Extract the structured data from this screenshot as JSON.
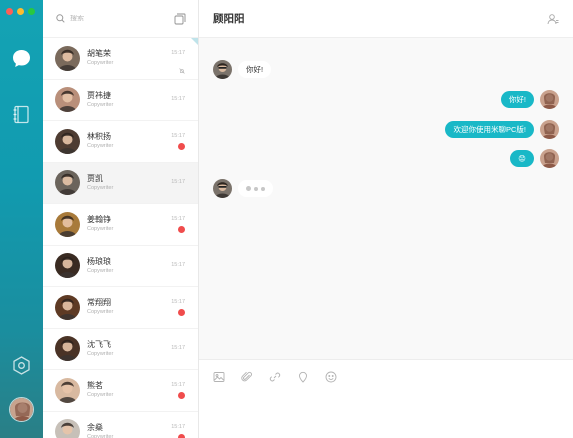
{
  "app": {
    "accent": "#19b8c7",
    "rail_gradient": [
      "#14a3b4",
      "#2a7f86"
    ]
  },
  "rail": {
    "items": [
      {
        "icon": "chat-bubble-icon"
      },
      {
        "icon": "contacts-book-icon"
      },
      {
        "icon": "settings-hex-icon"
      }
    ]
  },
  "list": {
    "search_placeholder": "搜索",
    "contacts": [
      {
        "name": "胡笔荣",
        "subtitle": "Copywriter",
        "time": "15:17",
        "indicator": "mute",
        "avatar": "#7a6a5c"
      },
      {
        "name": "贾祎捷",
        "subtitle": "Copywriter",
        "time": "15:17",
        "indicator": "none",
        "avatar": "#b98f7a"
      },
      {
        "name": "林积扬",
        "subtitle": "Copywriter",
        "time": "15:17",
        "indicator": "unread",
        "avatar": "#4e3c32"
      },
      {
        "name": "贾凯",
        "subtitle": "Copywriter",
        "time": "15:17",
        "indicator": "none",
        "avatar": "#6b645c",
        "active": true
      },
      {
        "name": "姜翰铮",
        "subtitle": "Copywriter",
        "time": "15:17",
        "indicator": "unread",
        "avatar": "#a87a3a"
      },
      {
        "name": "杨琅琅",
        "subtitle": "Copywriter",
        "time": "15:17",
        "indicator": "none",
        "avatar": "#3a2b22"
      },
      {
        "name": "常翔翔",
        "subtitle": "Copywriter",
        "time": "15:17",
        "indicator": "unread",
        "avatar": "#5e3a24"
      },
      {
        "name": "沈飞飞",
        "subtitle": "Copywriter",
        "time": "15:17",
        "indicator": "none",
        "avatar": "#4a3326"
      },
      {
        "name": "熊茗",
        "subtitle": "Copywriter",
        "time": "15:17",
        "indicator": "unread",
        "avatar": "#d8b9a0"
      },
      {
        "name": "余燊",
        "subtitle": "Copywriter",
        "time": "15:17",
        "indicator": "unread",
        "avatar": "#c7c0b8"
      }
    ]
  },
  "chat": {
    "title": "顾阳阳",
    "messages": [
      {
        "direction": "in",
        "text": "你好!"
      },
      {
        "direction": "out",
        "text": "你好!"
      },
      {
        "direction": "out",
        "text": "欢迎你使用米聊PC版!"
      },
      {
        "direction": "out",
        "text": "😟"
      },
      {
        "direction": "in",
        "typing": true
      }
    ],
    "toolbar": [
      "image-icon",
      "attachment-icon",
      "link-icon",
      "location-pin-icon",
      "emoji-icon"
    ]
  }
}
